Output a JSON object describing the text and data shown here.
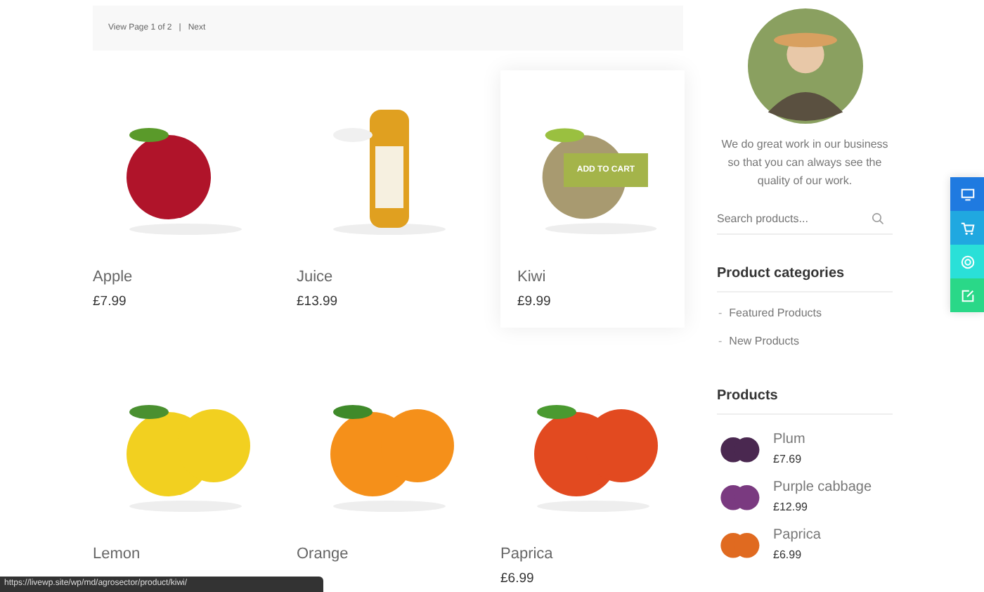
{
  "pagination": {
    "text": "View Page 1 of 2",
    "separator": "|",
    "next": "Next"
  },
  "products": [
    {
      "name": "Apple",
      "price": "£7.99",
      "hovered": false
    },
    {
      "name": "Juice",
      "price": "£13.99",
      "hovered": false
    },
    {
      "name": "Kiwi",
      "price": "£9.99",
      "hovered": true,
      "button": "ADD TO CART"
    },
    {
      "name": "Lemon",
      "hovered": false
    },
    {
      "name": "Orange",
      "hovered": false
    },
    {
      "name": "Paprica",
      "price": "£6.99",
      "hovered": false
    }
  ],
  "sidebar": {
    "about": "We do great work in our business so that you can always see the quality of our work.",
    "search": {
      "placeholder": "Search products..."
    },
    "categories_title": "Product categories",
    "categories": [
      {
        "bullet": "-",
        "label": "Featured Products"
      },
      {
        "bullet": "-",
        "label": "New Products"
      }
    ],
    "products_title": "Products",
    "products": [
      {
        "name": "Plum",
        "price": "£7.69"
      },
      {
        "name": "Purple cabbage",
        "price": "£12.99"
      },
      {
        "name": "Paprica",
        "price": "£6.99"
      }
    ]
  },
  "status_bar": {
    "url": "https://livewp.site/wp/md/agrosector/product/kiwi/"
  }
}
